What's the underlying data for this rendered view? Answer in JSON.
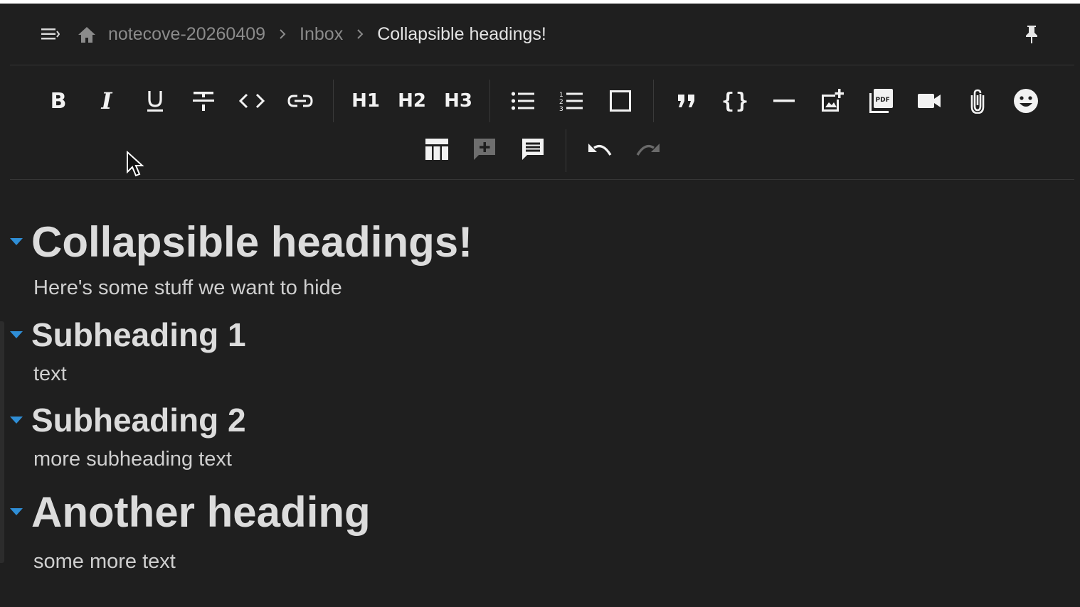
{
  "breadcrumb": {
    "items": [
      "notecove-20260409",
      "Inbox",
      "Collapsible headings!"
    ]
  },
  "toolbar": {
    "h1_label": "H1",
    "h2_label": "H2",
    "h3_label": "H3",
    "pdf_label": "PDF"
  },
  "document": {
    "h1": "Collapsible headings!",
    "p1": "Here's some stuff we want to hide",
    "h2a": "Subheading 1",
    "p2": "text",
    "h2b": "Subheading 2",
    "p3": "more subheading text",
    "h1b": "Another heading",
    "p4": "some more text"
  },
  "colors": {
    "background": "#1f1f1f",
    "toggle": "#2f8ed6",
    "text": "#dcdcdc",
    "muted": "#8b8b8b"
  }
}
